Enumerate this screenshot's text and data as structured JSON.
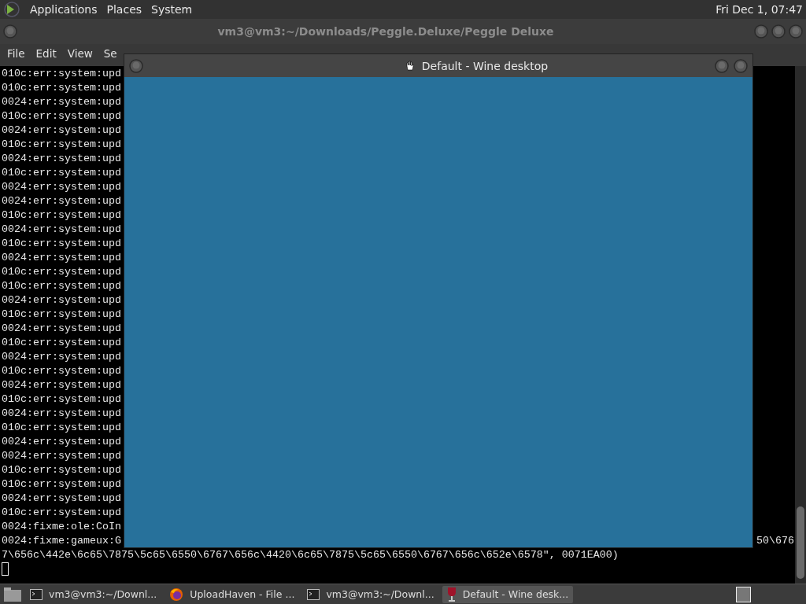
{
  "top_panel": {
    "menus": [
      "Applications",
      "Places",
      "System"
    ],
    "clock": "Fri Dec 1, 07:47"
  },
  "terminal_window": {
    "title": "vm3@vm3:~/Downloads/Peggle.Deluxe/Peggle Deluxe",
    "menu": [
      "File",
      "Edit",
      "View",
      "Se"
    ],
    "lines": [
      {
        "text": "010c:err:system:upd"
      },
      {
        "text": "010c:err:system:upd"
      },
      {
        "text": "0024:err:system:upd"
      },
      {
        "text": "010c:err:system:upd"
      },
      {
        "text": "0024:err:system:upd"
      },
      {
        "text": "010c:err:system:upd"
      },
      {
        "text": "0024:err:system:upd"
      },
      {
        "text": "010c:err:system:upd"
      },
      {
        "text": "0024:err:system:upd"
      },
      {
        "text": "0024:err:system:upd"
      },
      {
        "text": "010c:err:system:upd"
      },
      {
        "text": "0024:err:system:upd"
      },
      {
        "text": "010c:err:system:upd"
      },
      {
        "text": "0024:err:system:upd"
      },
      {
        "text": "010c:err:system:upd"
      },
      {
        "text": "010c:err:system:upd"
      },
      {
        "text": "0024:err:system:upd"
      },
      {
        "text": "010c:err:system:upd"
      },
      {
        "text": "0024:err:system:upd"
      },
      {
        "text": "010c:err:system:upd"
      },
      {
        "text": "0024:err:system:upd"
      },
      {
        "text": "010c:err:system:upd"
      },
      {
        "text": "0024:err:system:upd"
      },
      {
        "text": "010c:err:system:upd"
      },
      {
        "text": "0024:err:system:upd"
      },
      {
        "text": "010c:err:system:upd"
      },
      {
        "text": "0024:err:system:upd"
      },
      {
        "text": "0024:err:system:upd"
      },
      {
        "text": "010c:err:system:upd"
      },
      {
        "text": "010c:err:system:upd"
      },
      {
        "text": "0024:err:system:upd"
      },
      {
        "text": "010c:err:system:upd"
      },
      {
        "text": "0024:fixme:ole:CoIn"
      },
      {
        "text": "0024:fixme:gameux:G",
        "right": "50\\676"
      },
      {
        "text": "7\\656c\\442e\\6c65\\7875\\5c65\\6550\\6767\\656c\\4420\\6c65\\7875\\5c65\\6550\\6767\\656c\\652e\\6578\", 0071EA00)"
      }
    ]
  },
  "wine_window": {
    "title": "Default - Wine desktop"
  },
  "taskbar": {
    "tasks": [
      {
        "label": "vm3@vm3:~/Downl...",
        "kind": "terminal",
        "selected": false
      },
      {
        "label": "UploadHaven - File ...",
        "kind": "browser",
        "selected": false
      },
      {
        "label": "vm3@vm3:~/Downl...",
        "kind": "terminal",
        "selected": false
      },
      {
        "label": "Default - Wine desk...",
        "kind": "wine",
        "selected": true
      }
    ]
  }
}
